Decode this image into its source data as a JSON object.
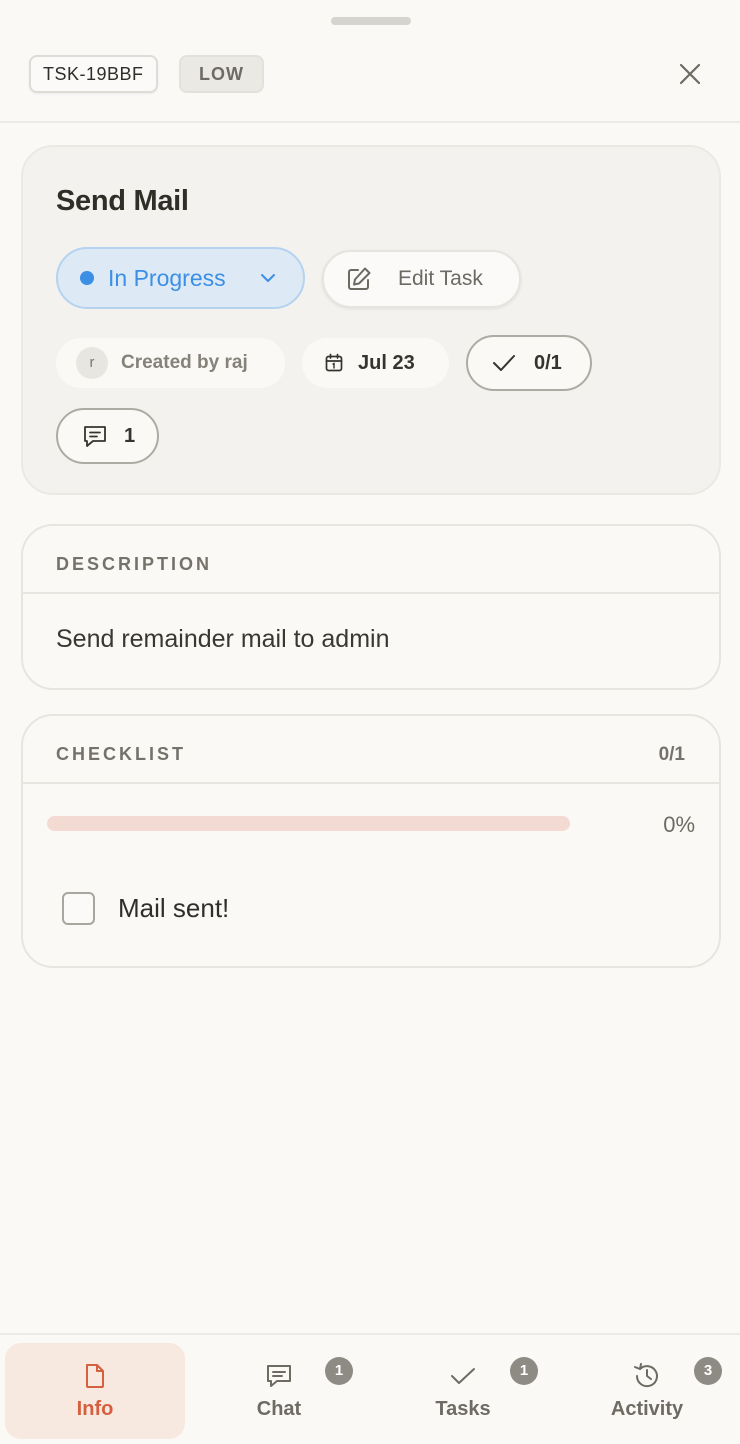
{
  "header": {
    "task_id": "TSK-19BBF",
    "priority": "LOW"
  },
  "task": {
    "title": "Send Mail",
    "status": "In Progress",
    "edit_label": "Edit Task",
    "creator_initial": "r",
    "created_by": "Created by raj",
    "due_date": "Jul 23",
    "checklist_summary": "0/1",
    "comments_count": "1"
  },
  "description": {
    "heading": "DESCRIPTION",
    "text": "Send remainder mail to admin"
  },
  "checklist": {
    "heading": "CHECKLIST",
    "count": "0/1",
    "progress_percent": 0,
    "progress_label": "0%",
    "items": [
      {
        "label": "Mail sent!",
        "checked": false
      }
    ]
  },
  "nav": {
    "tabs": [
      {
        "label": "Info",
        "icon": "document-icon",
        "active": true,
        "badge": ""
      },
      {
        "label": "Chat",
        "icon": "chat-icon",
        "active": false,
        "badge": "1"
      },
      {
        "label": "Tasks",
        "icon": "check-icon",
        "active": false,
        "badge": "1"
      },
      {
        "label": "Activity",
        "icon": "history-icon",
        "active": false,
        "badge": "3"
      }
    ]
  },
  "colors": {
    "accent": "#d4603f",
    "status_blue": "#3b8fe5",
    "progress_track": "#f3dbd3"
  }
}
